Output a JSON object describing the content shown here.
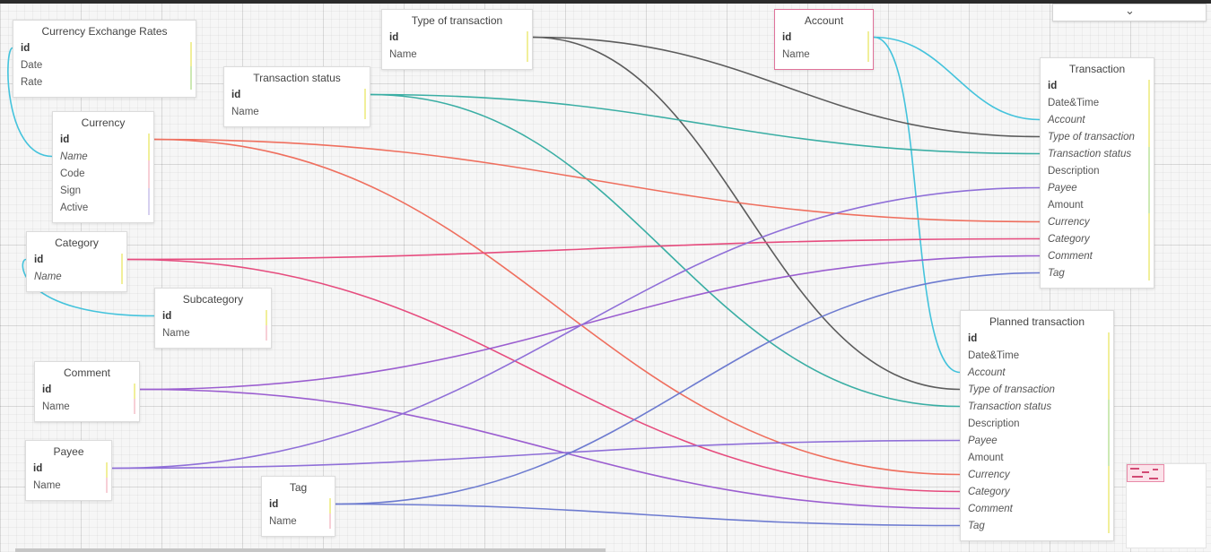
{
  "toolbar": {
    "dropdown_icon": "chevron-down-icon",
    "dropdown_glyph": "⌄"
  },
  "colors": {
    "cyan": "#44c3dc",
    "teal": "#3aaea4",
    "gray": "#5c5c5c",
    "salmon": "#ef6f5e",
    "pink": "#e64c7e",
    "violet": "#9b5ed0",
    "lavender": "#8f6fd8",
    "blue": "#6d7bd0",
    "selected_border": "#e0729a"
  },
  "entities": [
    {
      "id": "currency_exchange_rates",
      "title": "Currency Exchange Rates",
      "fields": [
        {
          "name": "id",
          "kind": "pk"
        },
        {
          "name": "Date",
          "kind": "plain"
        },
        {
          "name": "Rate",
          "kind": "plain"
        }
      ]
    },
    {
      "id": "transaction_status",
      "title": "Transaction status",
      "fields": [
        {
          "name": "id",
          "kind": "pk"
        },
        {
          "name": "Name",
          "kind": "plain"
        }
      ]
    },
    {
      "id": "type_of_transaction",
      "title": "Type of transaction",
      "fields": [
        {
          "name": "id",
          "kind": "pk"
        },
        {
          "name": "Name",
          "kind": "plain"
        }
      ]
    },
    {
      "id": "account",
      "title": "Account",
      "selected": true,
      "fields": [
        {
          "name": "id",
          "kind": "pk"
        },
        {
          "name": "Name",
          "kind": "plain"
        }
      ]
    },
    {
      "id": "currency",
      "title": "Currency",
      "fields": [
        {
          "name": "id",
          "kind": "pk"
        },
        {
          "name": "Name",
          "kind": "fk"
        },
        {
          "name": "Code",
          "kind": "plain"
        },
        {
          "name": "Sign",
          "kind": "plain"
        },
        {
          "name": "Active",
          "kind": "plain"
        }
      ]
    },
    {
      "id": "category",
      "title": "Category",
      "fields": [
        {
          "name": "id",
          "kind": "pk"
        },
        {
          "name": "Name",
          "kind": "fk"
        }
      ]
    },
    {
      "id": "subcategory",
      "title": "Subcategory",
      "fields": [
        {
          "name": "id",
          "kind": "pk"
        },
        {
          "name": "Name",
          "kind": "plain"
        }
      ]
    },
    {
      "id": "comment",
      "title": "Comment",
      "fields": [
        {
          "name": "id",
          "kind": "pk"
        },
        {
          "name": "Name",
          "kind": "plain"
        }
      ]
    },
    {
      "id": "payee",
      "title": "Payee",
      "fields": [
        {
          "name": "id",
          "kind": "pk"
        },
        {
          "name": "Name",
          "kind": "plain"
        }
      ]
    },
    {
      "id": "tag",
      "title": "Tag",
      "fields": [
        {
          "name": "id",
          "kind": "pk"
        },
        {
          "name": "Name",
          "kind": "plain"
        }
      ]
    },
    {
      "id": "transaction",
      "title": "Transaction",
      "fields": [
        {
          "name": "id",
          "kind": "pk"
        },
        {
          "name": "Date&Time",
          "kind": "plain"
        },
        {
          "name": "Account",
          "kind": "fk"
        },
        {
          "name": "Type of transaction",
          "kind": "fk"
        },
        {
          "name": "Transaction status",
          "kind": "fk"
        },
        {
          "name": "Description",
          "kind": "plain"
        },
        {
          "name": "Payee",
          "kind": "fk"
        },
        {
          "name": "Amount",
          "kind": "plain"
        },
        {
          "name": "Currency",
          "kind": "fk"
        },
        {
          "name": "Category",
          "kind": "fk"
        },
        {
          "name": "Comment",
          "kind": "fk"
        },
        {
          "name": "Tag",
          "kind": "fk"
        }
      ]
    },
    {
      "id": "planned_transaction",
      "title": "Planned transaction",
      "fields": [
        {
          "name": "id",
          "kind": "pk"
        },
        {
          "name": "Date&Time",
          "kind": "plain"
        },
        {
          "name": "Account",
          "kind": "fk"
        },
        {
          "name": "Type of transaction",
          "kind": "fk"
        },
        {
          "name": "Transaction status",
          "kind": "fk"
        },
        {
          "name": "Description",
          "kind": "plain"
        },
        {
          "name": "Payee",
          "kind": "fk"
        },
        {
          "name": "Amount",
          "kind": "plain"
        },
        {
          "name": "Currency",
          "kind": "fk"
        },
        {
          "name": "Category",
          "kind": "fk"
        },
        {
          "name": "Comment",
          "kind": "fk"
        },
        {
          "name": "Tag",
          "kind": "fk"
        }
      ]
    }
  ],
  "relations": [
    {
      "from": "currency_exchange_rates",
      "from_field": 0,
      "to": "currency",
      "to_field": 1,
      "color": "cyan",
      "loop": true
    },
    {
      "from": "category",
      "from_field": 0,
      "to": "subcategory",
      "to_field": 0,
      "color": "cyan",
      "loop": true
    },
    {
      "from": "account",
      "from_field": 0,
      "to": "transaction",
      "to_field": 2,
      "color": "cyan"
    },
    {
      "from": "account",
      "from_field": 0,
      "to": "planned_transaction",
      "to_field": 2,
      "color": "cyan"
    },
    {
      "from": "type_of_transaction",
      "from_field": 0,
      "to": "transaction",
      "to_field": 3,
      "color": "gray"
    },
    {
      "from": "type_of_transaction",
      "from_field": 0,
      "to": "planned_transaction",
      "to_field": 3,
      "color": "gray"
    },
    {
      "from": "transaction_status",
      "from_field": 0,
      "to": "transaction",
      "to_field": 4,
      "color": "teal"
    },
    {
      "from": "transaction_status",
      "from_field": 0,
      "to": "planned_transaction",
      "to_field": 4,
      "color": "teal"
    },
    {
      "from": "currency",
      "from_field": 0,
      "to": "transaction",
      "to_field": 8,
      "color": "salmon"
    },
    {
      "from": "currency",
      "from_field": 0,
      "to": "planned_transaction",
      "to_field": 8,
      "color": "salmon"
    },
    {
      "from": "category",
      "from_field": 0,
      "to": "transaction",
      "to_field": 9,
      "color": "pink"
    },
    {
      "from": "category",
      "from_field": 0,
      "to": "planned_transaction",
      "to_field": 9,
      "color": "pink"
    },
    {
      "from": "comment",
      "from_field": 0,
      "to": "transaction",
      "to_field": 10,
      "color": "violet"
    },
    {
      "from": "comment",
      "from_field": 0,
      "to": "planned_transaction",
      "to_field": 10,
      "color": "violet"
    },
    {
      "from": "payee",
      "from_field": 0,
      "to": "transaction",
      "to_field": 6,
      "color": "lavender"
    },
    {
      "from": "payee",
      "from_field": 0,
      "to": "planned_transaction",
      "to_field": 6,
      "color": "lavender"
    },
    {
      "from": "tag",
      "from_field": 0,
      "to": "transaction",
      "to_field": 11,
      "color": "blue"
    },
    {
      "from": "tag",
      "from_field": 0,
      "to": "planned_transaction",
      "to_field": 11,
      "color": "blue"
    }
  ]
}
